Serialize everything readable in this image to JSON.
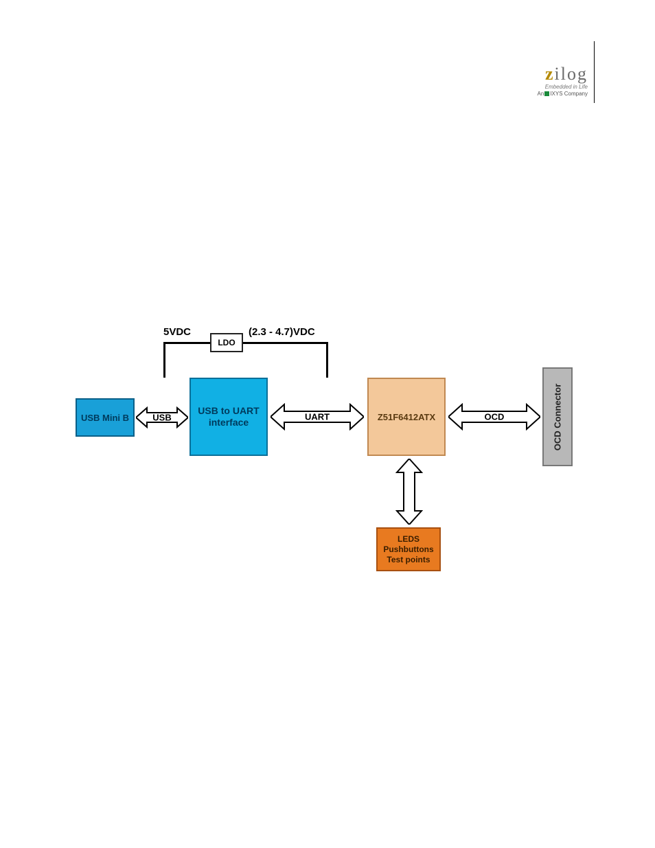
{
  "logo": {
    "name_z": "z",
    "name_rest": "ilog",
    "tag1": "Embedded in Life",
    "tag2_prefix": "An",
    "tag2_company": "IXYS",
    "tag2_suffix": " Company"
  },
  "diagram": {
    "power": {
      "left_label": "5VDC",
      "ldo_label": "LDO",
      "right_label": "(2.3 - 4.7)VDC"
    },
    "blocks": {
      "usb_mini": "USB Mini B",
      "usb_uart_line1": "USB to UART",
      "usb_uart_line2": "interface",
      "mcu": "Z51F6412ATX",
      "ocd_connector": "OCD Connector",
      "leds_line1": "LEDS",
      "leds_line2": "Pushbuttons",
      "leds_line3": "Test points"
    },
    "arrows": {
      "usb": "USB",
      "uart": "UART",
      "ocd": "OCD"
    }
  }
}
